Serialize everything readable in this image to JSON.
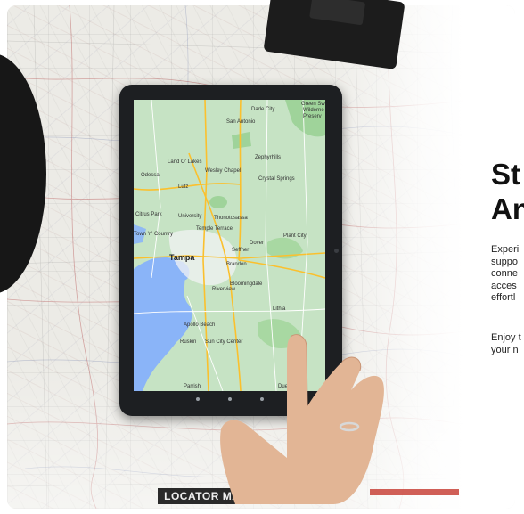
{
  "hero": {
    "heading_lines": [
      "St",
      "An"
    ],
    "description_lines": [
      "Experi",
      "suppo",
      "conne",
      "acces",
      "effortl"
    ],
    "enjoy_lines": [
      "Enjoy t",
      "your n"
    ]
  },
  "image": {
    "locator_label": "LOCATOR MAP",
    "tablet_map": {
      "city_label": "Tampa",
      "places": [
        "Dade City",
        "San Antonio",
        "Green Sw",
        "Wilderne",
        "Preserv",
        "Zephyrhills",
        "Land O' Lakes",
        "Wesley Chapel",
        "Odessa",
        "Lutz",
        "Crystal Springs",
        "Citrus Park",
        "University",
        "Thonotosassa",
        "Temple Terrace",
        "Town 'n' Country",
        "Dover",
        "Plant City",
        "Seffner",
        "Brandon",
        "Riverview",
        "Bloomingdale",
        "Lithia",
        "Apollo Beach",
        "Ruskin",
        "Sun City Center",
        "Parrish",
        "Duette"
      ]
    }
  },
  "colors": {
    "map_land": "#c6e3c4",
    "map_water": "#8ab4f8",
    "tablet_bezel": "#1d1f22",
    "heading_text": "#111111"
  }
}
